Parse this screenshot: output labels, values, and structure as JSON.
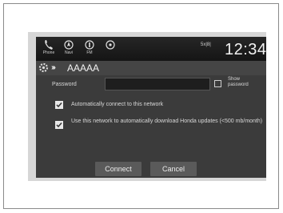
{
  "statusbar": {
    "nav_items": [
      {
        "label": "Phone",
        "icon": "phone-icon"
      },
      {
        "label": "Navi",
        "icon": "navigation-icon"
      },
      {
        "label": "FM",
        "icon": "radio-icon"
      },
      {
        "label": "",
        "icon": "voice-icon"
      }
    ],
    "signal_text": "5x|8|",
    "clock": "12:34"
  },
  "titlebar": {
    "network_name": "AAAAA"
  },
  "form": {
    "password_label": "Password",
    "password_value": "",
    "show_password_label": "Show password",
    "show_password_checked": false,
    "auto_connect_label": "Automatically connect to this network",
    "auto_connect_checked": true,
    "updates_label": "Use this network to automatically download Honda updates (<500 mb/month)",
    "updates_checked": true
  },
  "buttons": {
    "connect": "Connect",
    "cancel": "Cancel"
  },
  "colors": {
    "screen_bg": "#3b3b3b",
    "button_bg": "#5a5a5a",
    "text": "#e6e6e6"
  }
}
